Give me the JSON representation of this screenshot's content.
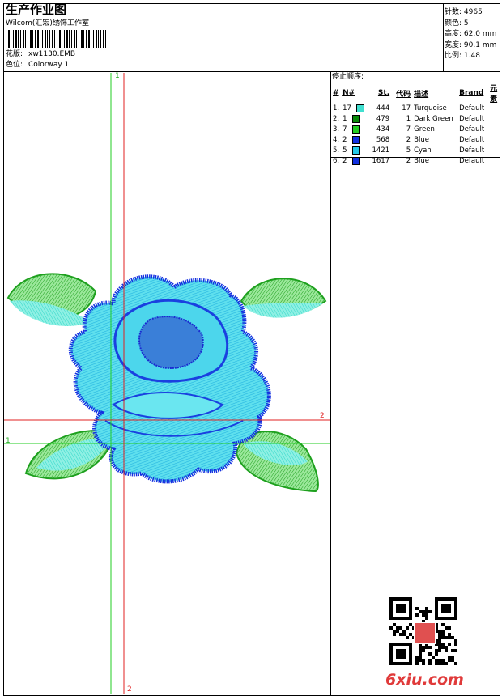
{
  "header": {
    "title": "生产作业图",
    "company": "Wilcom(汇宏)绣饰工作室",
    "design_label": "花版:",
    "design_value": "xw1130.EMB",
    "colorway_label": "色位:",
    "colorway_value": "Colorway 1"
  },
  "stats": [
    {
      "label": "针数:",
      "value": "4965"
    },
    {
      "label": "颜色:",
      "value": "5"
    },
    {
      "label": "高度:",
      "value": "62.0 mm"
    },
    {
      "label": "宽度:",
      "value": "90.1 mm"
    },
    {
      "label": "比例:",
      "value": "1.48"
    }
  ],
  "stop_sequence": {
    "title": "停止顺序:",
    "columns": [
      "#",
      "N#",
      "St.",
      "代码",
      "描述",
      "Brand",
      "元素"
    ],
    "rows": [
      {
        "num": "1.",
        "needle": "17",
        "color": "#40e0d0",
        "stitches": "444",
        "code": "17",
        "desc": "Turquoise",
        "brand": "Default"
      },
      {
        "num": "2.",
        "needle": "1",
        "color": "#0a8a0a",
        "stitches": "479",
        "code": "1",
        "desc": "Dark Green",
        "brand": "Default"
      },
      {
        "num": "3.",
        "needle": "7",
        "color": "#22cc22",
        "stitches": "434",
        "code": "7",
        "desc": "Green",
        "brand": "Default"
      },
      {
        "num": "4.",
        "needle": "2",
        "color": "#1030e0",
        "stitches": "568",
        "code": "2",
        "desc": "Blue",
        "brand": "Default"
      },
      {
        "num": "5.",
        "needle": "5",
        "color": "#22c8e8",
        "stitches": "1421",
        "code": "5",
        "desc": "Cyan",
        "brand": "Default"
      },
      {
        "num": "6.",
        "needle": "2",
        "color": "#1030e0",
        "stitches": "1617",
        "code": "2",
        "desc": "Blue",
        "brand": "Default"
      }
    ]
  },
  "axes": {
    "green_label_top": "1",
    "green_label_left": "1",
    "red_label_right": "2",
    "red_label_bottom": "2"
  },
  "watermark": {
    "text": "6xiu.com"
  }
}
